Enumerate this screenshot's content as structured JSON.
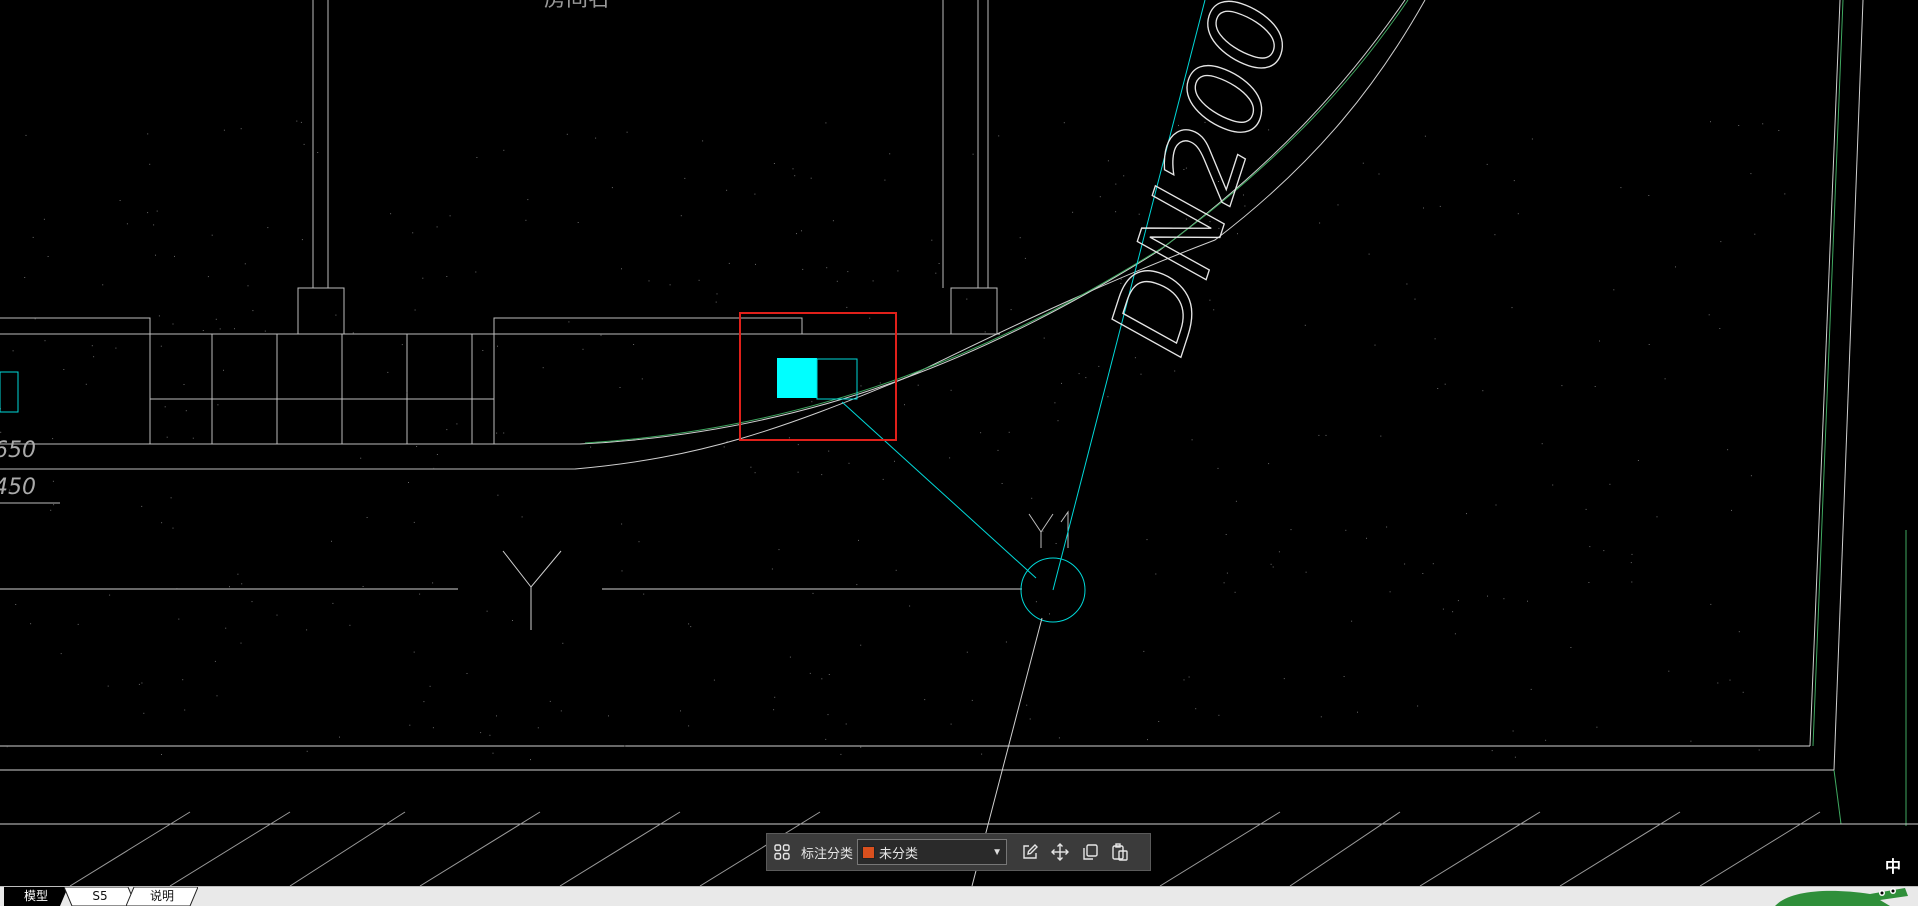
{
  "drawing": {
    "labels": {
      "top_fragment": "房间名",
      "dim_upper": "650",
      "dim_lower": "450",
      "y_marker": "Y",
      "y1_marker": "Y1",
      "pipe_label": "DN200"
    }
  },
  "annotation_toolbar": {
    "category_label": "标注分类",
    "category_value": "未分类",
    "category_color": "#d9501e"
  },
  "layout_tabs": [
    {
      "label": "模型",
      "active": true
    },
    {
      "label": "S5",
      "active": false
    },
    {
      "label": "说明",
      "active": false
    }
  ],
  "ime_indicator": "中",
  "colors": {
    "background": "#000000",
    "line_gray": "#bfbfbf",
    "line_cyan": "#00d8d8",
    "line_green": "#3fa860",
    "highlight_red": "#e0201a"
  }
}
